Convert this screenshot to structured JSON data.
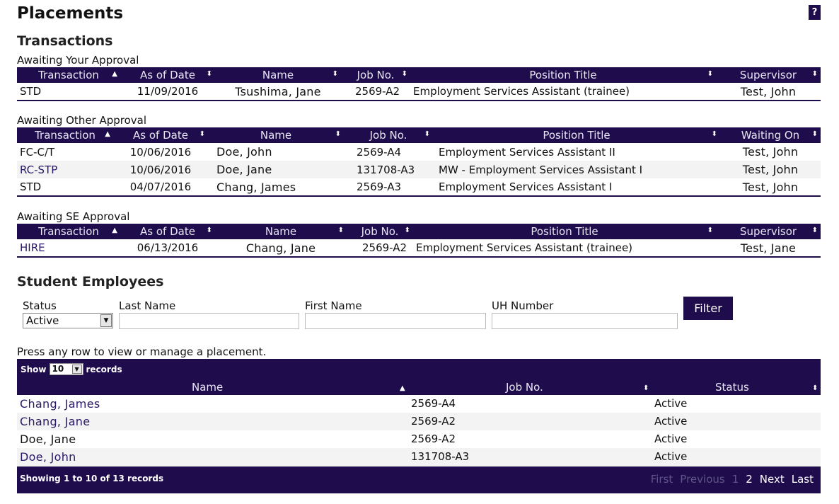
{
  "page": {
    "title": "Placements",
    "help_label": "?"
  },
  "transactions": {
    "title": "Transactions",
    "your_approval": {
      "label": "Awaiting Your Approval",
      "headers": [
        "Transaction",
        "As of Date",
        "Name",
        "Job No.",
        "Position Title",
        "Supervisor"
      ],
      "rows": [
        [
          "STD",
          "11/09/2016",
          "Tsushima, Jane",
          "2569-A2",
          "Employment Services Assistant (trainee)",
          "Test, John"
        ]
      ]
    },
    "other_approval": {
      "label": "Awaiting Other Approval",
      "headers": [
        "Transaction",
        "As of Date",
        "Name",
        "Job No.",
        "Position Title",
        "Waiting On"
      ],
      "rows": [
        [
          "FC-C/T",
          "10/06/2016",
          "Doe, John",
          "2569-A4",
          "Employment Services Assistant II",
          "Test, John"
        ],
        [
          "RC-STP",
          "10/06/2016",
          "Doe, Jane",
          "131708-A3",
          "MW - Employment Services Assistant I",
          "Test, John"
        ],
        [
          "STD",
          "04/07/2016",
          "Chang, James",
          "2569-A3",
          "Employment Services Assistant I",
          "Test, John"
        ]
      ]
    },
    "se_approval": {
      "label": "Awaiting SE Approval",
      "headers": [
        "Transaction",
        "As of Date",
        "Name",
        "Job No.",
        "Position Title",
        "Supervisor"
      ],
      "rows": [
        [
          "HIRE",
          "06/13/2016",
          "Chang, Jane",
          "2569-A2",
          "Employment Services Assistant (trainee)",
          "Test, Jane"
        ]
      ]
    }
  },
  "students": {
    "title": "Student Employees",
    "filters": {
      "status_label": "Status",
      "status_value": "Active",
      "last_name_label": "Last Name",
      "first_name_label": "First Name",
      "uh_number_label": "UH Number",
      "last_name_value": "",
      "first_name_value": "",
      "uh_number_value": "",
      "filter_button": "Filter"
    },
    "note": "Press any row to view or manage a placement.",
    "show_label": "Show",
    "show_value": "10",
    "records_label": "records",
    "headers": [
      "Name",
      "Job No.",
      "Status"
    ],
    "rows": [
      [
        "Chang, James",
        "2569-A4",
        "Active"
      ],
      [
        "Chang, Jane",
        "2569-A2",
        "Active"
      ],
      [
        "Doe, Jane",
        "2569-A2",
        "Active"
      ],
      [
        "Doe, John",
        "131708-A3",
        "Active"
      ]
    ],
    "footer_info": "Showing 1 to 10 of 13 records",
    "pager": {
      "first": "First",
      "previous": "Previous",
      "page1": "1",
      "page2": "2",
      "next": "Next",
      "last": "Last"
    }
  },
  "colors": {
    "header_bg": "#1f0c4d",
    "row_alt": "#f3f3f3",
    "link": "#2a1866"
  }
}
